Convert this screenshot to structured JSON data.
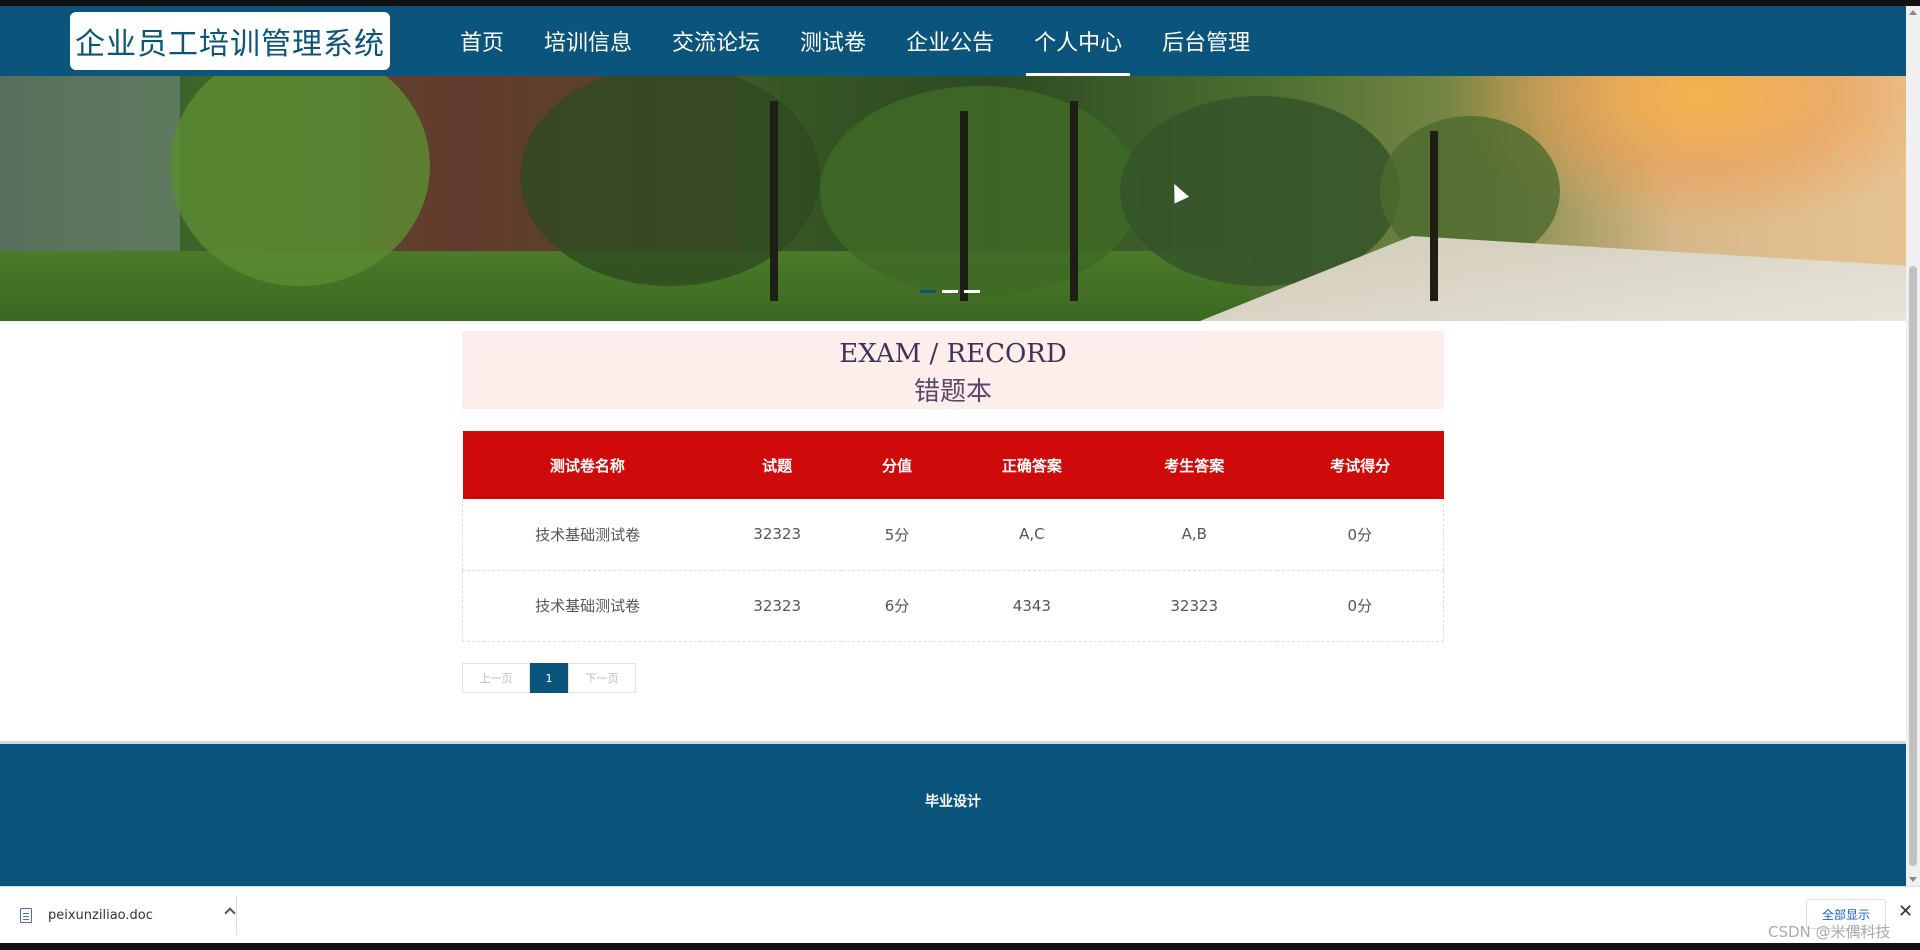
{
  "header": {
    "brand": "企业员工培训管理系统",
    "nav": [
      "首页",
      "培训信息",
      "交流论坛",
      "测试卷",
      "企业公告",
      "个人中心",
      "后台管理"
    ],
    "active": "个人中心"
  },
  "section": {
    "title_en": "EXAM / RECORD",
    "title_cn": "错题本"
  },
  "table": {
    "columns": [
      "测试卷名称",
      "试题",
      "分值",
      "正确答案",
      "考生答案",
      "考试得分"
    ],
    "rows": [
      [
        "技术基础测试卷",
        "32323",
        "5分",
        "A,C",
        "A,B",
        "0分"
      ],
      [
        "技术基础测试卷",
        "32323",
        "6分",
        "4343",
        "32323",
        "0分"
      ]
    ]
  },
  "pagination": {
    "prev": "上一页",
    "current": "1",
    "next": "下一页"
  },
  "footer": {
    "text": "毕业设计"
  },
  "download": {
    "filename": "peixunziliao.doc",
    "show_all": "全部显示",
    "close": "✕"
  },
  "watermark": "CSDN @米偶科技",
  "colors": {
    "brand": "#0b547b",
    "table_header": "#cf0a0a",
    "section_bg": "#fdeeeb"
  }
}
